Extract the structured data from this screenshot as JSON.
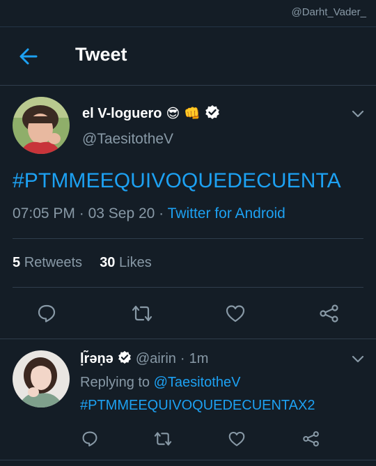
{
  "watermark": "@Darht_Vader_",
  "header": {
    "title": "Tweet"
  },
  "tweet": {
    "display_name": "el V-loguero",
    "name_emojis": [
      "😎",
      "👊"
    ],
    "verified": true,
    "handle": "@TaesitotheV",
    "text": "#PTMMEEQUIVOQUEDECUENTA",
    "time": "07:05 PM",
    "date": "03 Sep 20",
    "source": "Twitter for Android",
    "retweets_count": "5",
    "retweets_label": "Retweets",
    "likes_count": "30",
    "likes_label": "Likes"
  },
  "reply": {
    "display_name": "ḷr̃əṇə",
    "verified": true,
    "handle": "@airin",
    "time": "1m",
    "replying_to_label": "Replying to",
    "replying_to_handle": "@TaesitotheV",
    "text": "#PTMMEEQUIVOQUEDECUENTAX2"
  },
  "icons": {
    "back": "arrow-left-icon",
    "reply": "comment-icon",
    "retweet": "retweet-icon",
    "like": "heart-icon",
    "share": "share-icon",
    "verified": "verified-badge-icon",
    "more": "chevron-down-icon"
  },
  "colors": {
    "background": "#141d26",
    "accent": "#1da1f2",
    "secondary_text": "#8899a6",
    "divider": "#2f3d4c"
  }
}
